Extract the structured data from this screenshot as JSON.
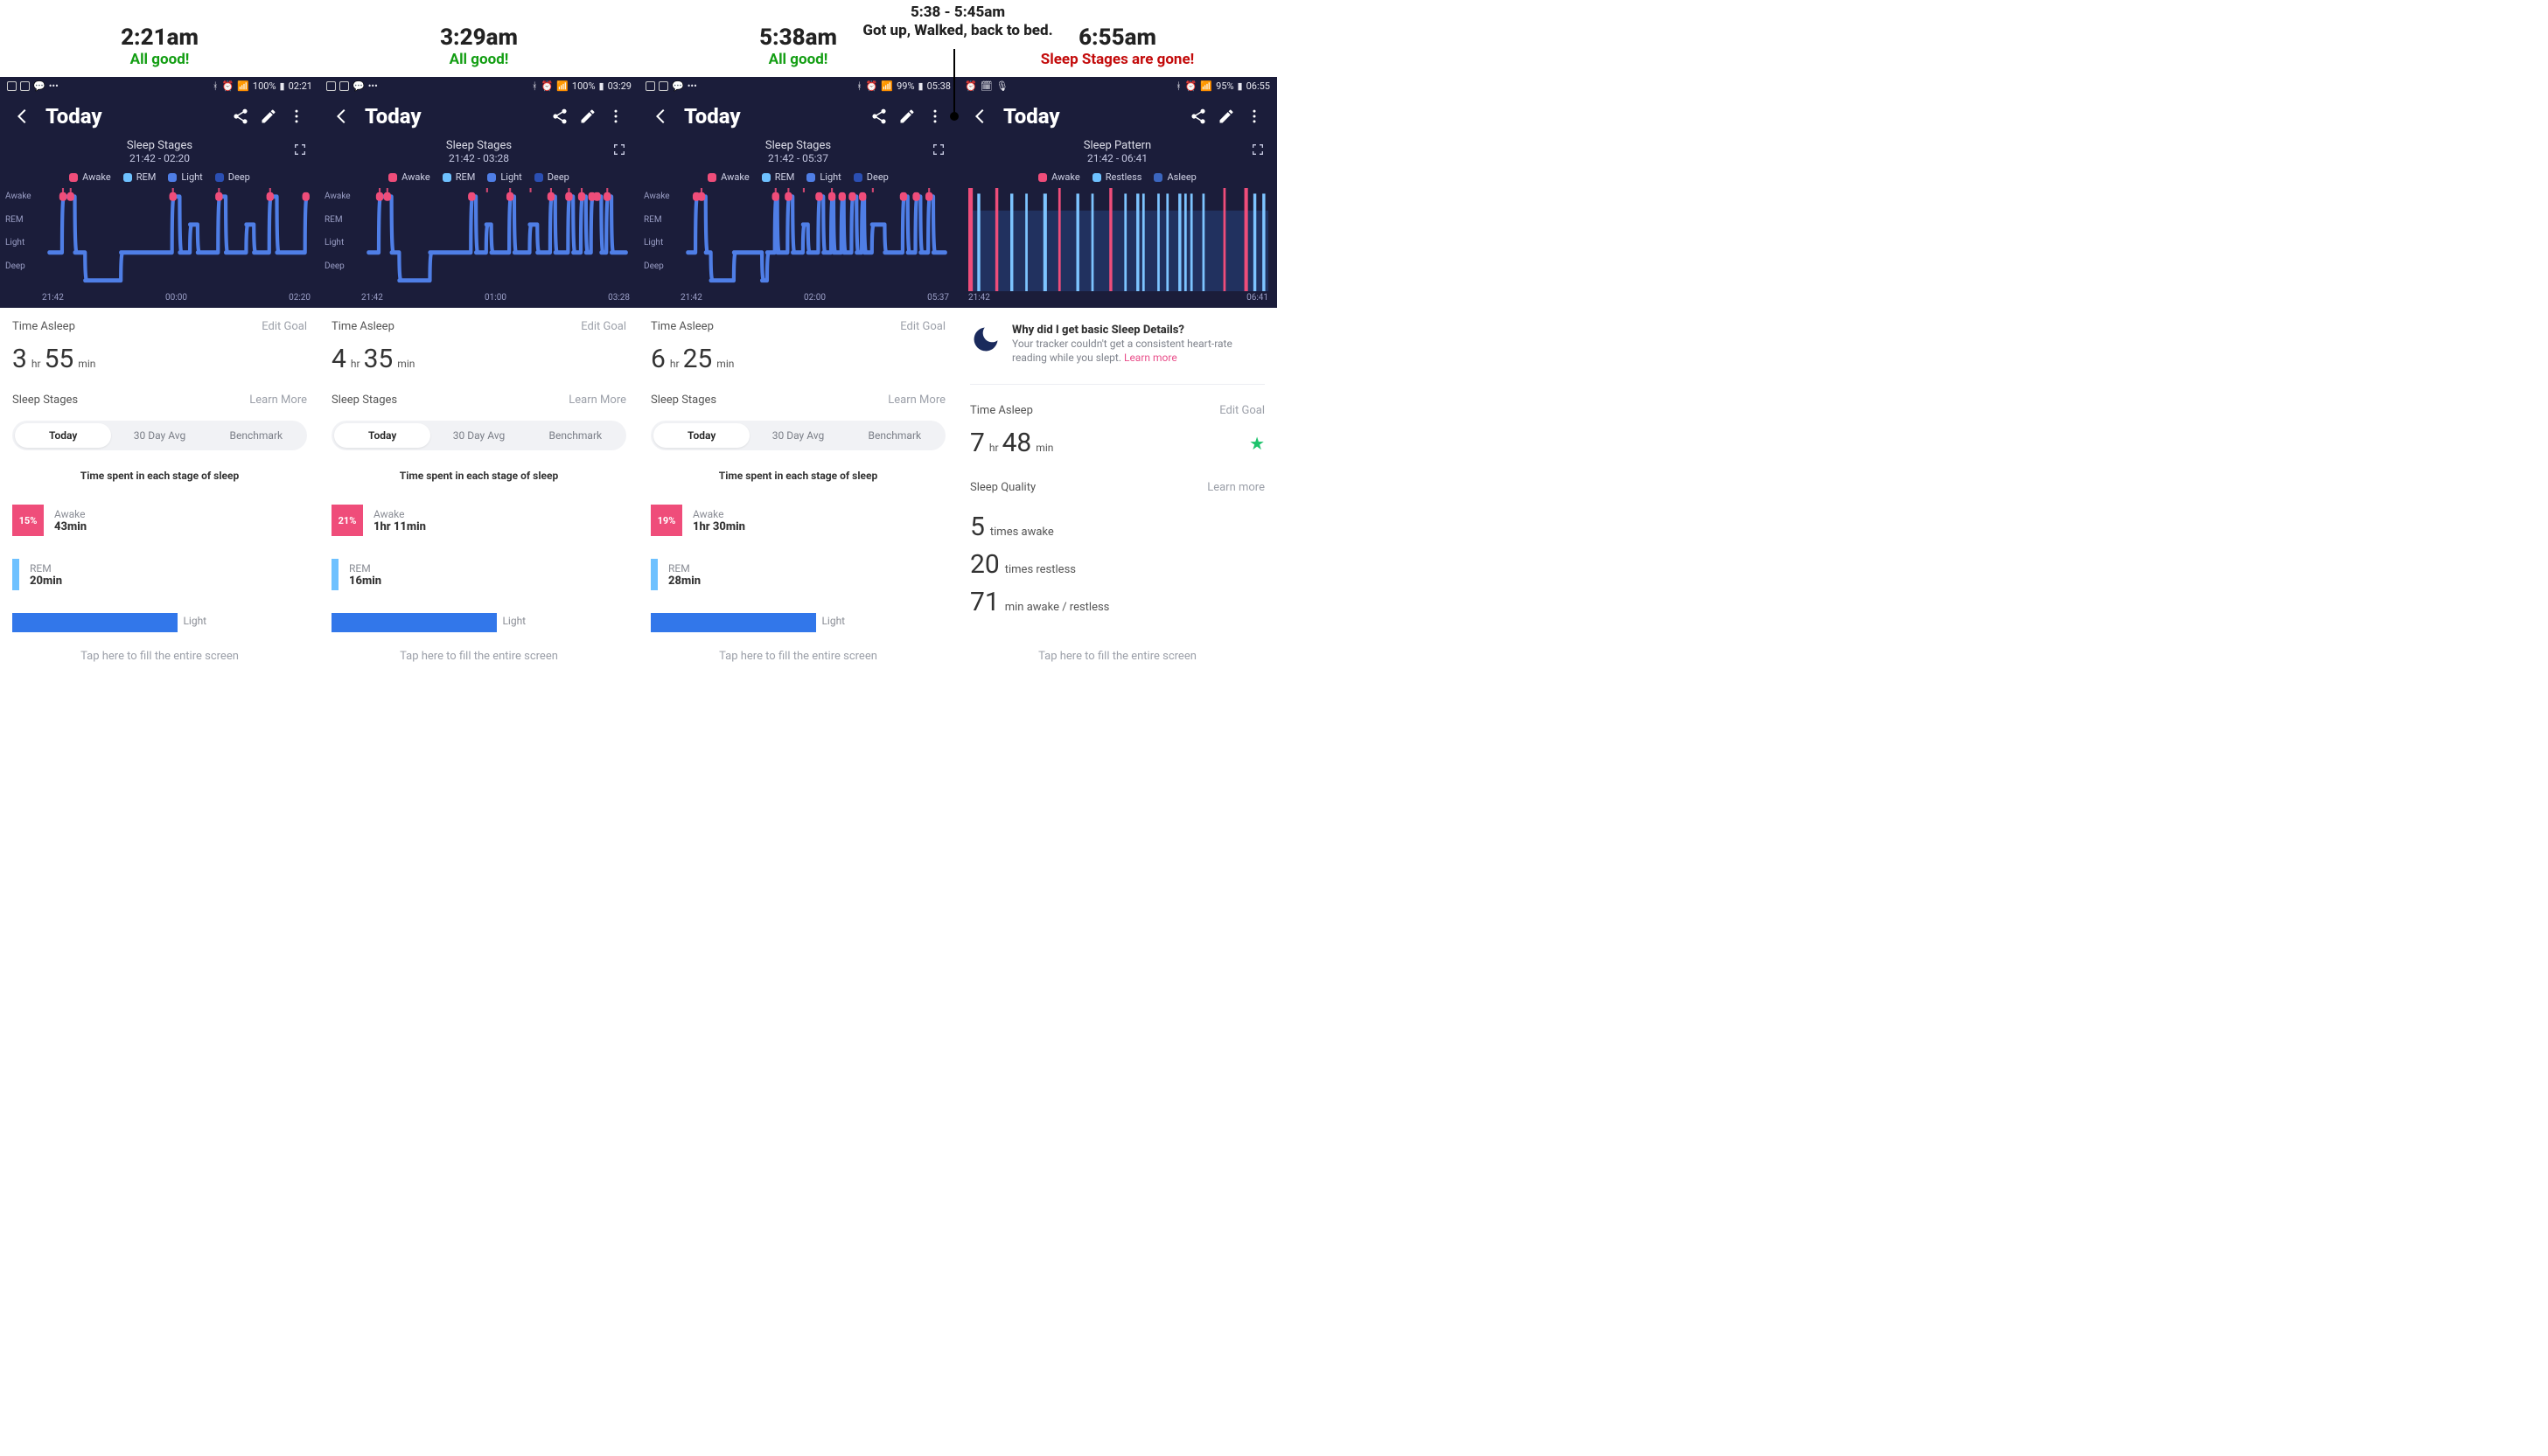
{
  "footer_text": "Tap here to fill the entire screen",
  "callout": {
    "time": "5:38 - 5:45am",
    "text": "Got up, Walked, back to bed."
  },
  "legendA": [
    "Awake",
    "REM",
    "Light",
    "Deep"
  ],
  "legendB": [
    "Awake",
    "Restless",
    "Asleep"
  ],
  "segments": {
    "today": "Today",
    "avg": "30 Day Avg",
    "bench": "Benchmark"
  },
  "stage_legend_title": "Time spent in each stage of sleep",
  "labels": {
    "time_asleep": "Time Asleep",
    "edit_goal": "Edit Goal",
    "sleep_stages": "Sleep Stages",
    "learn_more": "Learn More",
    "learn_more_lc": "Learn more",
    "sleep_quality": "Sleep Quality",
    "light": "Light",
    "rem": "REM",
    "awake": "Awake"
  },
  "screens": [
    {
      "caption_time": "2:21am",
      "caption_status": "All good!",
      "status_ok": true,
      "status_text": "100%",
      "status_time": "02:21",
      "appbar_title": "Today",
      "chart_title": "Sleep Stages",
      "chart_range": "21:42 - 02:20",
      "ylabels": [
        "Awake",
        "REM",
        "Light",
        "Deep"
      ],
      "xaxis": [
        "21:42",
        "00:00",
        "02:20"
      ],
      "asleep": {
        "h": "3",
        "m": "55"
      },
      "stageA": {
        "pct": "15%",
        "name": "Awake",
        "val": "43min"
      },
      "stageB": {
        "name": "REM",
        "val": "20min"
      }
    },
    {
      "caption_time": "3:29am",
      "caption_status": "All good!",
      "status_ok": true,
      "status_text": "100%",
      "status_time": "03:29",
      "appbar_title": "Today",
      "chart_title": "Sleep Stages",
      "chart_range": "21:42 - 03:28",
      "ylabels": [
        "Awake",
        "REM",
        "Light",
        "Deep"
      ],
      "xaxis": [
        "21:42",
        "01:00",
        "03:28"
      ],
      "asleep": {
        "h": "4",
        "m": "35"
      },
      "stageA": {
        "pct": "21%",
        "name": "Awake",
        "val": "1hr 11min"
      },
      "stageB": {
        "name": "REM",
        "val": "16min"
      }
    },
    {
      "caption_time": "5:38am",
      "caption_status": "All good!",
      "status_ok": true,
      "status_text": "99%",
      "status_time": "05:38",
      "appbar_title": "Today",
      "chart_title": "Sleep Stages",
      "chart_range": "21:42 - 05:37",
      "ylabels": [
        "Awake",
        "REM",
        "Light",
        "Deep"
      ],
      "xaxis": [
        "21:42",
        "02:00",
        "05:37"
      ],
      "asleep": {
        "h": "6",
        "m": "25"
      },
      "stageA": {
        "pct": "19%",
        "name": "Awake",
        "val": "1hr 30min"
      },
      "stageB": {
        "name": "REM",
        "val": "28min"
      }
    },
    {
      "caption_time": "6:55am",
      "caption_status": "Sleep Stages are gone!",
      "status_ok": false,
      "status_text": "95%",
      "status_time": "06:55",
      "appbar_title": "Today",
      "chart_title": "Sleep Pattern",
      "chart_range": "21:42 - 06:41",
      "xaxis": [
        "21:42",
        "06:41"
      ],
      "asleep": {
        "h": "7",
        "m": "48"
      },
      "info": {
        "title": "Why did I get basic Sleep Details?",
        "desc": "Your tracker couldn't get a consistent heart-rate reading while you slept.",
        "link": "Learn more"
      },
      "quality": {
        "awake_n": "5",
        "awake_t": "times awake",
        "restless_n": "20",
        "restless_t": "times restless",
        "mins_n": "71",
        "mins_t": "min awake / restless"
      }
    }
  ],
  "chart_data": [
    {
      "type": "step",
      "variant": "stages",
      "levels": [
        "Awake",
        "REM",
        "Light",
        "Deep"
      ],
      "x_range": [
        "21:42",
        "02:20"
      ],
      "points": [
        {
          "t": 0.0,
          "l": 2
        },
        {
          "t": 0.05,
          "l": 0
        },
        {
          "t": 0.08,
          "l": 0
        },
        {
          "t": 0.1,
          "l": 2
        },
        {
          "t": 0.14,
          "l": 3
        },
        {
          "t": 0.26,
          "l": 3
        },
        {
          "t": 0.28,
          "l": 2
        },
        {
          "t": 0.46,
          "l": 2
        },
        {
          "t": 0.48,
          "l": 0
        },
        {
          "t": 0.51,
          "l": 2
        },
        {
          "t": 0.55,
          "l": 1
        },
        {
          "t": 0.58,
          "l": 2
        },
        {
          "t": 0.66,
          "l": 0
        },
        {
          "t": 0.69,
          "l": 2
        },
        {
          "t": 0.77,
          "l": 1
        },
        {
          "t": 0.8,
          "l": 2
        },
        {
          "t": 0.86,
          "l": 0
        },
        {
          "t": 0.89,
          "l": 2
        },
        {
          "t": 0.94,
          "l": 2
        },
        {
          "t": 1.0,
          "l": 0
        }
      ]
    },
    {
      "type": "step",
      "variant": "stages",
      "levels": [
        "Awake",
        "REM",
        "Light",
        "Deep"
      ],
      "x_range": [
        "21:42",
        "03:28"
      ],
      "points": [
        {
          "t": 0.0,
          "l": 2
        },
        {
          "t": 0.04,
          "l": 0
        },
        {
          "t": 0.07,
          "l": 0
        },
        {
          "t": 0.09,
          "l": 2
        },
        {
          "t": 0.12,
          "l": 3
        },
        {
          "t": 0.22,
          "l": 3
        },
        {
          "t": 0.24,
          "l": 2
        },
        {
          "t": 0.38,
          "l": 2
        },
        {
          "t": 0.4,
          "l": 0
        },
        {
          "t": 0.42,
          "l": 2
        },
        {
          "t": 0.46,
          "l": 1
        },
        {
          "t": 0.48,
          "l": 2
        },
        {
          "t": 0.55,
          "l": 0
        },
        {
          "t": 0.57,
          "l": 2
        },
        {
          "t": 0.63,
          "l": 1
        },
        {
          "t": 0.66,
          "l": 2
        },
        {
          "t": 0.71,
          "l": 0
        },
        {
          "t": 0.73,
          "l": 2
        },
        {
          "t": 0.78,
          "l": 0
        },
        {
          "t": 0.8,
          "l": 2
        },
        {
          "t": 0.83,
          "l": 0
        },
        {
          "t": 0.85,
          "l": 2
        },
        {
          "t": 0.87,
          "l": 0
        },
        {
          "t": 0.89,
          "l": 0
        },
        {
          "t": 0.91,
          "l": 2
        },
        {
          "t": 0.93,
          "l": 0
        },
        {
          "t": 0.95,
          "l": 2
        },
        {
          "t": 1.0,
          "l": 2
        }
      ]
    },
    {
      "type": "step",
      "variant": "stages",
      "levels": [
        "Awake",
        "REM",
        "Light",
        "Deep"
      ],
      "x_range": [
        "21:42",
        "05:37"
      ],
      "points": [
        {
          "t": 0.0,
          "l": 2
        },
        {
          "t": 0.03,
          "l": 0
        },
        {
          "t": 0.05,
          "l": 0
        },
        {
          "t": 0.07,
          "l": 2
        },
        {
          "t": 0.09,
          "l": 3
        },
        {
          "t": 0.17,
          "l": 3
        },
        {
          "t": 0.18,
          "l": 2
        },
        {
          "t": 0.28,
          "l": 2
        },
        {
          "t": 0.29,
          "l": 3
        },
        {
          "t": 0.31,
          "l": 2
        },
        {
          "t": 0.34,
          "l": 0
        },
        {
          "t": 0.35,
          "l": 2
        },
        {
          "t": 0.39,
          "l": 0
        },
        {
          "t": 0.41,
          "l": 2
        },
        {
          "t": 0.45,
          "l": 1
        },
        {
          "t": 0.47,
          "l": 2
        },
        {
          "t": 0.51,
          "l": 0
        },
        {
          "t": 0.53,
          "l": 2
        },
        {
          "t": 0.56,
          "l": 0
        },
        {
          "t": 0.57,
          "l": 2
        },
        {
          "t": 0.6,
          "l": 0
        },
        {
          "t": 0.61,
          "l": 2
        },
        {
          "t": 0.64,
          "l": 0
        },
        {
          "t": 0.66,
          "l": 2
        },
        {
          "t": 0.68,
          "l": 0
        },
        {
          "t": 0.69,
          "l": 2
        },
        {
          "t": 0.72,
          "l": 1
        },
        {
          "t": 0.76,
          "l": 1
        },
        {
          "t": 0.77,
          "l": 2
        },
        {
          "t": 0.84,
          "l": 0
        },
        {
          "t": 0.86,
          "l": 2
        },
        {
          "t": 0.89,
          "l": 0
        },
        {
          "t": 0.91,
          "l": 2
        },
        {
          "t": 0.94,
          "l": 0
        },
        {
          "t": 0.96,
          "l": 2
        },
        {
          "t": 1.0,
          "l": 2
        }
      ]
    },
    {
      "type": "bands",
      "variant": "pattern",
      "levels": [
        "Awake",
        "Restless",
        "Asleep"
      ],
      "x_range": [
        "21:42",
        "06:41"
      ],
      "bands": [
        {
          "t": 0.0,
          "w": 0.015,
          "l": 0
        },
        {
          "t": 0.03,
          "w": 0.01,
          "l": 1
        },
        {
          "t": 0.09,
          "w": 0.01,
          "l": 0
        },
        {
          "t": 0.14,
          "w": 0.01,
          "l": 1
        },
        {
          "t": 0.19,
          "w": 0.008,
          "l": 1
        },
        {
          "t": 0.25,
          "w": 0.012,
          "l": 1
        },
        {
          "t": 0.3,
          "w": 0.008,
          "l": 0
        },
        {
          "t": 0.36,
          "w": 0.01,
          "l": 1
        },
        {
          "t": 0.41,
          "w": 0.008,
          "l": 1
        },
        {
          "t": 0.47,
          "w": 0.01,
          "l": 0
        },
        {
          "t": 0.52,
          "w": 0.008,
          "l": 1
        },
        {
          "t": 0.56,
          "w": 0.01,
          "l": 1
        },
        {
          "t": 0.58,
          "w": 0.008,
          "l": 1
        },
        {
          "t": 0.63,
          "w": 0.008,
          "l": 1
        },
        {
          "t": 0.66,
          "w": 0.008,
          "l": 1
        },
        {
          "t": 0.7,
          "w": 0.01,
          "l": 1
        },
        {
          "t": 0.72,
          "w": 0.008,
          "l": 1
        },
        {
          "t": 0.74,
          "w": 0.008,
          "l": 1
        },
        {
          "t": 0.78,
          "w": 0.008,
          "l": 1
        },
        {
          "t": 0.85,
          "w": 0.008,
          "l": 0
        },
        {
          "t": 0.92,
          "w": 0.012,
          "l": 0
        },
        {
          "t": 0.95,
          "w": 0.01,
          "l": 1
        },
        {
          "t": 0.98,
          "w": 0.01,
          "l": 1
        }
      ]
    }
  ]
}
